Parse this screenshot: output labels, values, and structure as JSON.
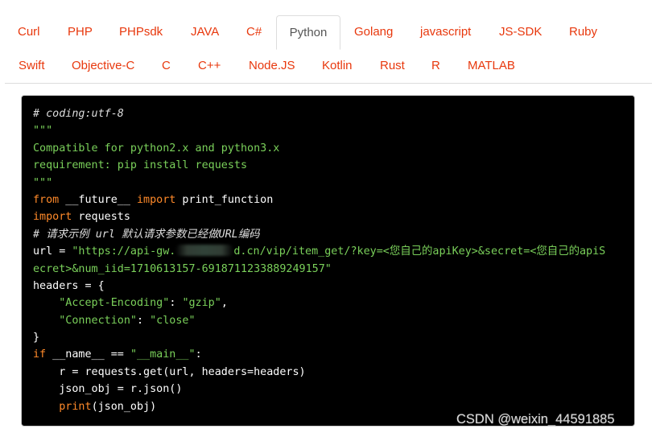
{
  "tabs": {
    "row1": [
      "Curl",
      "PHP",
      "PHPsdk",
      "JAVA",
      "C#",
      "Python",
      "Golang",
      "javascript",
      "JS-SDK",
      "Ruby"
    ],
    "row2": [
      "Swift",
      "Objective-C",
      "C",
      "C++",
      "Node.JS",
      "Kotlin",
      "Rust",
      "R",
      "MATLAB"
    ],
    "active": "Python"
  },
  "code": {
    "l1": "# coding:utf-8",
    "l2": "\"\"\"",
    "l3": "Compatible for python2.x and python3.x",
    "l4": "requirement: pip install requests",
    "l5": "\"\"\"",
    "l6_kw1": "from",
    "l6_a": " __future__ ",
    "l6_kw2": "import",
    "l6_b": " print_function",
    "l7_kw": "import",
    "l7_a": " requests",
    "l8": "# 请求示例 url 默认请求参数已经做URL编码",
    "l9_a": "url = ",
    "l9_s1": "\"https://api-gw.",
    "l9_s2": "d.cn/vip/item_get/?key=<您自己的apiKey>&secret=<您自己的apiS",
    "l10_s": "ecret>&num_iid=1710613157-6918711233889249157\"",
    "l11": "headers = {",
    "l12_s1": "    \"Accept-Encoding\"",
    "l12_p": ": ",
    "l12_s2": "\"gzip\"",
    "l12_e": ",",
    "l13_s1": "    \"Connection\"",
    "l13_p": ": ",
    "l13_s2": "\"close\"",
    "l14": "}",
    "l15_kw": "if",
    "l15_a": " __name__ == ",
    "l15_s": "\"__main__\"",
    "l15_e": ":",
    "l16": "    r = requests.get(url, headers=headers)",
    "l17": "    json_obj = r.json()",
    "l18_indent": "    ",
    "l18_fn": "print",
    "l18_a": "(json_obj)"
  },
  "watermark": "CSDN @weixin_44591885",
  "colors": {
    "tab_link": "#e8380d",
    "code_bg": "#000000",
    "string": "#7ad05a",
    "keyword": "#ff8a2a"
  }
}
